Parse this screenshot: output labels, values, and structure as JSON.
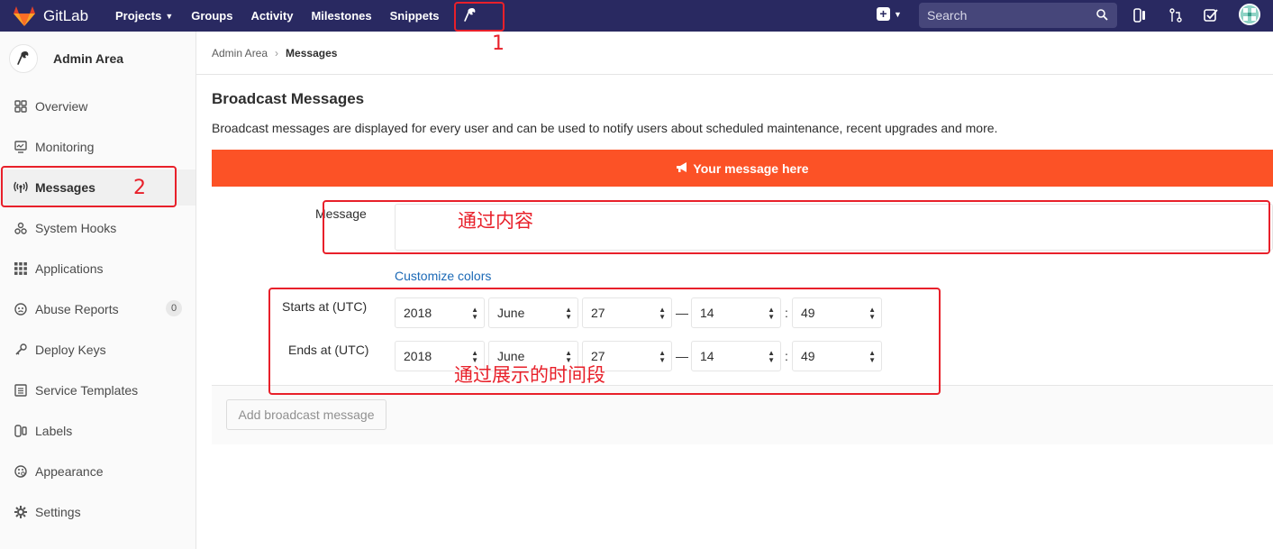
{
  "navbar": {
    "brand": "GitLab",
    "links": [
      {
        "label": "Projects",
        "has_dropdown": true
      },
      {
        "label": "Groups",
        "has_dropdown": false
      },
      {
        "label": "Activity",
        "has_dropdown": false
      },
      {
        "label": "Milestones",
        "has_dropdown": false
      },
      {
        "label": "Snippets",
        "has_dropdown": false
      }
    ],
    "search_placeholder": "Search",
    "colors": {
      "background": "#292961",
      "search_bg": "#46467a"
    },
    "icons": [
      "admin-wrench-icon",
      "new-plus-icon",
      "issues-icon",
      "merge-requests-icon",
      "todos-icon",
      "avatar"
    ]
  },
  "sidebar": {
    "title": "Admin Area",
    "items": [
      {
        "label": "Overview",
        "icon": "overview-grid-icon",
        "active": false
      },
      {
        "label": "Monitoring",
        "icon": "monitor-icon",
        "active": false
      },
      {
        "label": "Messages",
        "icon": "broadcast-icon",
        "active": true
      },
      {
        "label": "System Hooks",
        "icon": "hook-icon",
        "active": false
      },
      {
        "label": "Applications",
        "icon": "apps-grid-icon",
        "active": false
      },
      {
        "label": "Abuse Reports",
        "icon": "abuse-face-icon",
        "active": false,
        "badge": "0"
      },
      {
        "label": "Deploy Keys",
        "icon": "key-icon",
        "active": false
      },
      {
        "label": "Service Templates",
        "icon": "template-icon",
        "active": false
      },
      {
        "label": "Labels",
        "icon": "labels-icon",
        "active": false
      },
      {
        "label": "Appearance",
        "icon": "palette-icon",
        "active": false
      },
      {
        "label": "Settings",
        "icon": "settings-gear-icon",
        "active": false
      }
    ]
  },
  "breadcrumb": {
    "parent": "Admin Area",
    "current": "Messages"
  },
  "page": {
    "title": "Broadcast Messages",
    "description": "Broadcast messages are displayed for every user and can be used to notify users about scheduled maintenance, recent upgrades and more.",
    "banner_text": "Your message here",
    "banner_color": "#fc5226"
  },
  "form": {
    "message_label": "Message",
    "message_value": "",
    "customize_colors_link": "Customize colors",
    "starts_label": "Starts at (UTC)",
    "ends_label": "Ends at (UTC)",
    "starts": {
      "year": "2018",
      "month": "June",
      "day": "27",
      "hour": "14",
      "minute": "49"
    },
    "ends": {
      "year": "2018",
      "month": "June",
      "day": "27",
      "hour": "14",
      "minute": "49"
    },
    "date_time_separator": "—",
    "hour_minute_separator": ":",
    "submit_label": "Add broadcast message"
  },
  "annotations": {
    "num1": "1",
    "num2": "2",
    "message_note": "通过内容",
    "time_note": "通过展示的时间段",
    "color": "#e8202a"
  }
}
